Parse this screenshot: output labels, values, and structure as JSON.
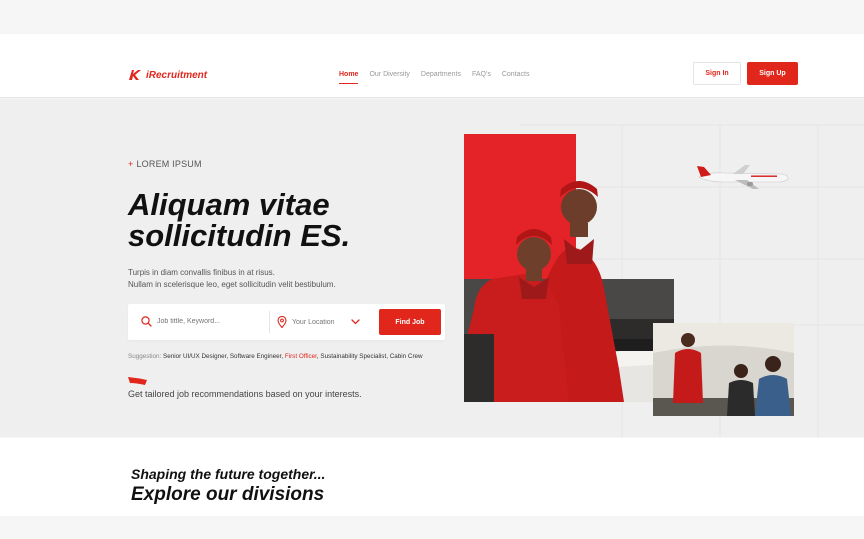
{
  "brand": {
    "name": "iRecruitment",
    "accent": "#e1261c"
  },
  "nav": {
    "items": [
      {
        "label": "Home",
        "active": true
      },
      {
        "label": "Our Diversity"
      },
      {
        "label": "Departments"
      },
      {
        "label": "FAQ's"
      },
      {
        "label": "Contacts"
      }
    ]
  },
  "auth": {
    "signin": "Sign In",
    "signup": "Sign Up"
  },
  "hero": {
    "eyebrow": "LOREM IPSUM",
    "eyebrow_mark": "+",
    "headline_line1": "Aliquam vitae",
    "headline_line2": "sollicitudin ES.",
    "sub_line1": "Turpis in diam convallis finibus in at risus.",
    "sub_line2": "Nullam in scelerisque leo, eget sollicitudin velit bestibulum.",
    "search": {
      "keyword_placeholder": "Job tittle, Keyword...",
      "location_placeholder": "Your Location",
      "button": "Find Job"
    },
    "suggestion": {
      "label": "Suggestion:",
      "before": "Senior UI/UX Designer, Software Engineer,",
      "highlight": "First Officer",
      "after": ", Sustainability Specialist, Cabin Crew"
    },
    "tailored": "Get tailored job recommendations based on your interests."
  },
  "divisions": {
    "line1": "Shaping the future together...",
    "line2": "Explore our divisions"
  },
  "icons": [
    "logo-mark-icon",
    "search-icon",
    "location-pin-icon",
    "chevron-down-icon",
    "airplane-icon"
  ]
}
